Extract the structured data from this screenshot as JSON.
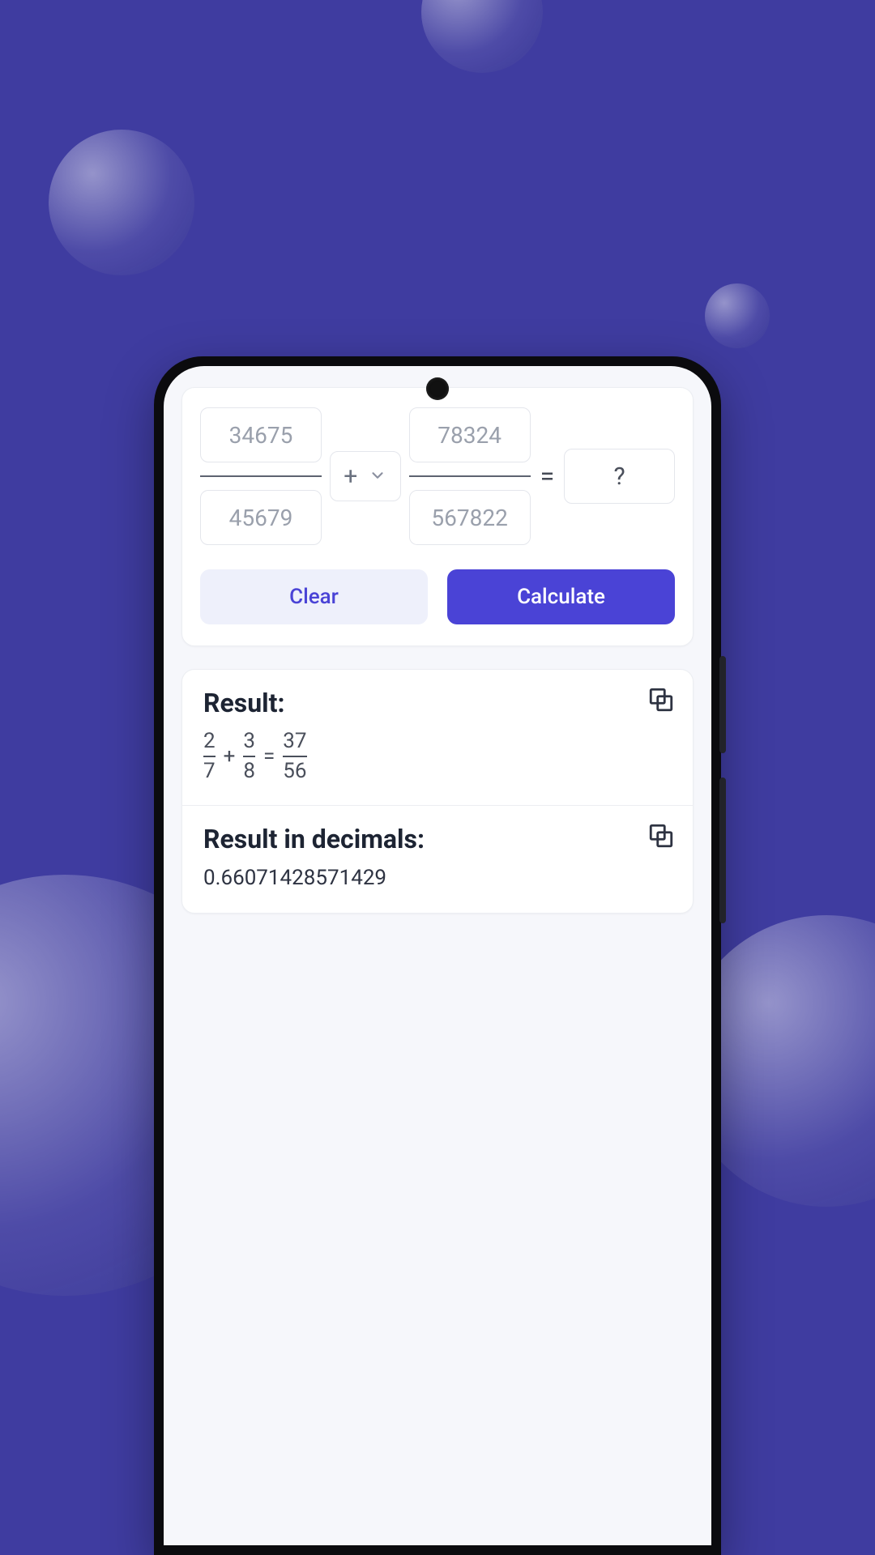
{
  "calculator": {
    "fraction1": {
      "numerator": "34675",
      "denominator": "45679"
    },
    "fraction2": {
      "numerator": "78324",
      "denominator": "567822"
    },
    "operator": "+",
    "equals": "=",
    "result_placeholder": "?",
    "buttons": {
      "clear": "Clear",
      "calculate": "Calculate"
    }
  },
  "results": {
    "fraction_title": "Result:",
    "decimal_title": "Result in decimals:",
    "expression": {
      "a_num": "2",
      "a_den": "7",
      "op": "+",
      "b_num": "3",
      "b_den": "8",
      "eq": "=",
      "r_num": "37",
      "r_den": "56"
    },
    "decimal_value": "0.66071428571429"
  }
}
